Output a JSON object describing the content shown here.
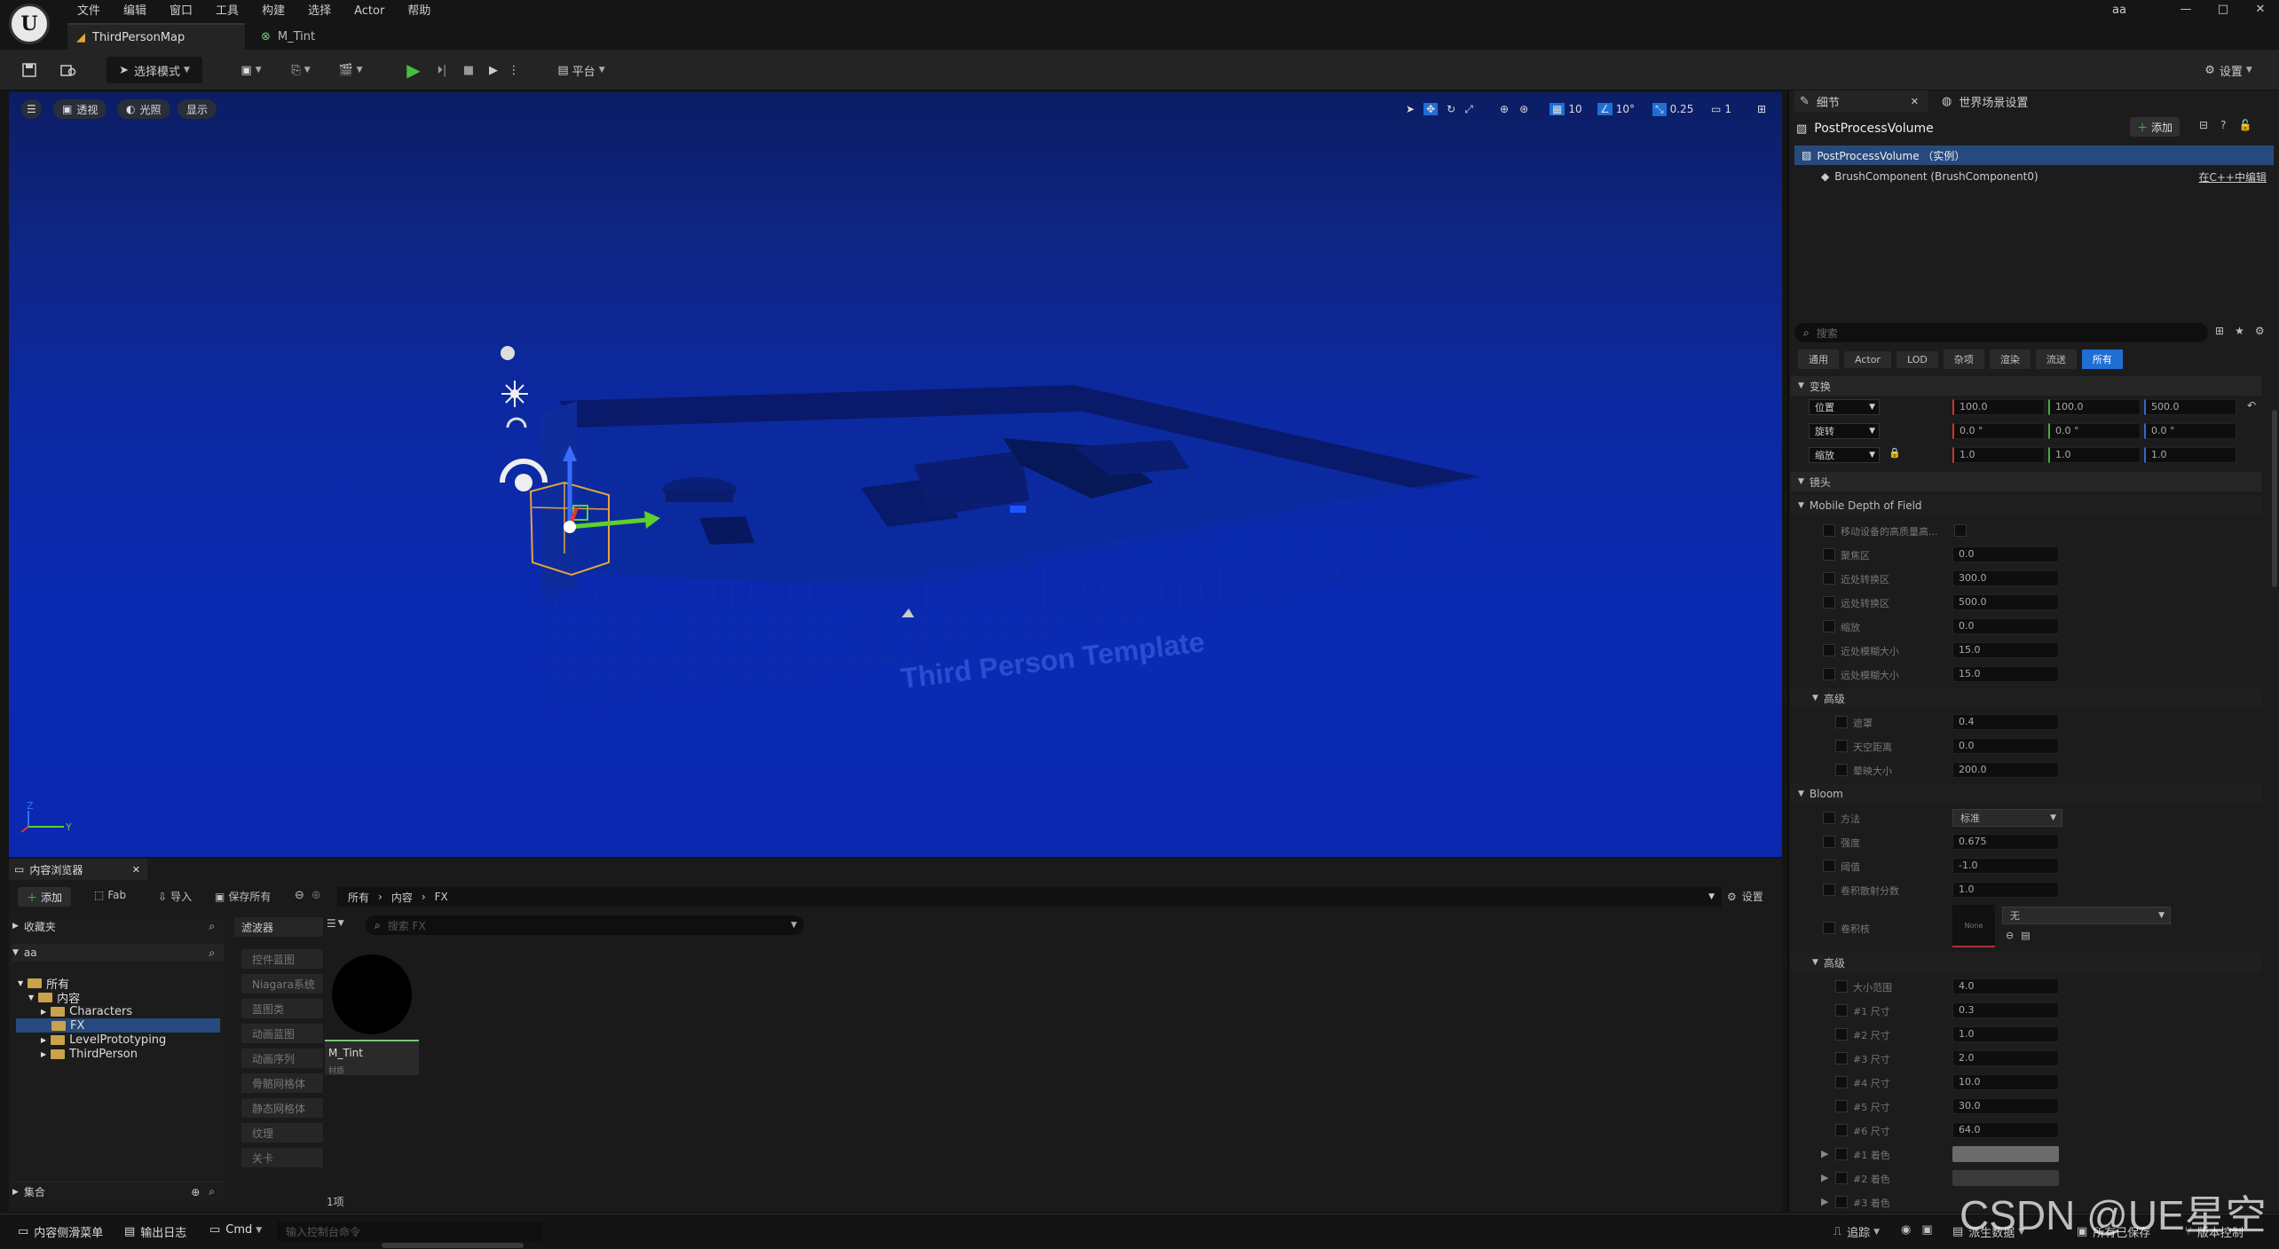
{
  "app": {
    "menu": [
      "文件",
      "编辑",
      "窗口",
      "工具",
      "构建",
      "选择",
      "Actor",
      "帮助"
    ],
    "project": "aa",
    "tabs": [
      {
        "label": "ThirdPersonMap"
      },
      {
        "label": "M_Tint"
      }
    ],
    "window_controls": [
      "—",
      "□",
      "✕"
    ]
  },
  "toolbar": {
    "select_mode": "选择模式",
    "platform": "平台",
    "settings": "设置"
  },
  "viewport": {
    "perspective": "透视",
    "lighting": "光照",
    "show": "显示",
    "grid_size": "10",
    "rotation_snap": "10°",
    "scale_snap": "0.25",
    "camera_speed": "1",
    "wall_text": "Third Person Template"
  },
  "details": {
    "tab_details": "细节",
    "tab_world": "世界场景设置",
    "actor_name": "PostProcessVolume",
    "add": "添加",
    "instance": "PostProcessVolume （实例）",
    "component": "BrushComponent (BrushComponent0)",
    "edit_cpp": "在C++中编辑",
    "search_placeholder": "搜索",
    "filters": [
      "通用",
      "Actor",
      "LOD",
      "杂项",
      "渲染",
      "流送",
      "所有"
    ],
    "section_transform": "变换",
    "location_label": "位置",
    "rotation_label": "旋转",
    "scale_label": "缩放",
    "location": [
      "100.0",
      "100.0",
      "500.0"
    ],
    "rotation": [
      "0.0 °",
      "0.0 °",
      "0.0 °"
    ],
    "scale": [
      "1.0",
      "1.0",
      "1.0"
    ],
    "section_lens": "镜头",
    "section_mdof": "Mobile Depth of Field",
    "mdof_rows": [
      {
        "label": "移动设备的高质量高...",
        "value": ""
      },
      {
        "label": "聚焦区",
        "value": "0.0"
      },
      {
        "label": "近处转换区",
        "value": "300.0"
      },
      {
        "label": "远处转换区",
        "value": "500.0"
      },
      {
        "label": "缩放",
        "value": "0.0"
      },
      {
        "label": "近处模糊大小",
        "value": "15.0"
      },
      {
        "label": "远处模糊大小",
        "value": "15.0"
      }
    ],
    "section_adv1": "高级",
    "adv1_rows": [
      {
        "label": "遮罩",
        "value": "0.4"
      },
      {
        "label": "天空距离",
        "value": "0.0"
      },
      {
        "label": "晕映大小",
        "value": "200.0"
      }
    ],
    "section_bloom": "Bloom",
    "bloom_method_label": "方法",
    "bloom_method": "标准",
    "bloom_rows": [
      {
        "label": "强度",
        "value": "0.675"
      },
      {
        "label": "阈值",
        "value": "-1.0"
      },
      {
        "label": "卷积散射分数",
        "value": "1.0"
      }
    ],
    "convolution_kernel_label": "卷积核",
    "convolution_kernel": "无",
    "thumb_none": "None",
    "section_adv2": "高级",
    "adv2_rows": [
      {
        "label": "大小范围",
        "value": "4.0"
      },
      {
        "label": "#1 尺寸",
        "value": "0.3"
      },
      {
        "label": "#2 尺寸",
        "value": "1.0"
      },
      {
        "label": "#3 尺寸",
        "value": "2.0"
      },
      {
        "label": "#4 尺寸",
        "value": "10.0"
      },
      {
        "label": "#5 尺寸",
        "value": "30.0"
      },
      {
        "label": "#6 尺寸",
        "value": "64.0"
      }
    ],
    "tint_rows": [
      "#1 着色",
      "#2 着色",
      "#3 着色"
    ]
  },
  "content_browser": {
    "title": "内容浏览器",
    "add": "添加",
    "fab": "Fab",
    "import": "导入",
    "save_all": "保存所有",
    "breadcrumb": [
      "所有",
      "内容",
      "FX"
    ],
    "settings": "设置",
    "favorites": "收藏夹",
    "project_root": "aa",
    "tree": [
      {
        "label": "所有",
        "depth": 0
      },
      {
        "label": "内容",
        "depth": 1
      },
      {
        "label": "Characters",
        "depth": 2
      },
      {
        "label": "FX",
        "depth": 2
      },
      {
        "label": "LevelPrototyping",
        "depth": 2
      },
      {
        "label": "ThirdPerson",
        "depth": 2
      }
    ],
    "collections": "集合",
    "filters_title": "滤波器",
    "filters": [
      "控件蓝图",
      "Niagara系统",
      "蓝图类",
      "动画蓝图",
      "动画序列",
      "骨骼网格体",
      "静态网格体",
      "纹理",
      "关卡"
    ],
    "search_placeholder": "搜索 FX",
    "asset_name": "M_Tint",
    "asset_type": "材质",
    "item_count": "1项"
  },
  "statusbar": {
    "content_drawer": "内容侧滑菜单",
    "output_log": "输出日志",
    "cmd": "Cmd",
    "console_placeholder": "输入控制台命令",
    "trace": "追踪",
    "derived_data": "派生数据",
    "all_saved": "所有已保存",
    "source_control": "版本控制"
  },
  "watermark": "CSDN @UE星空"
}
